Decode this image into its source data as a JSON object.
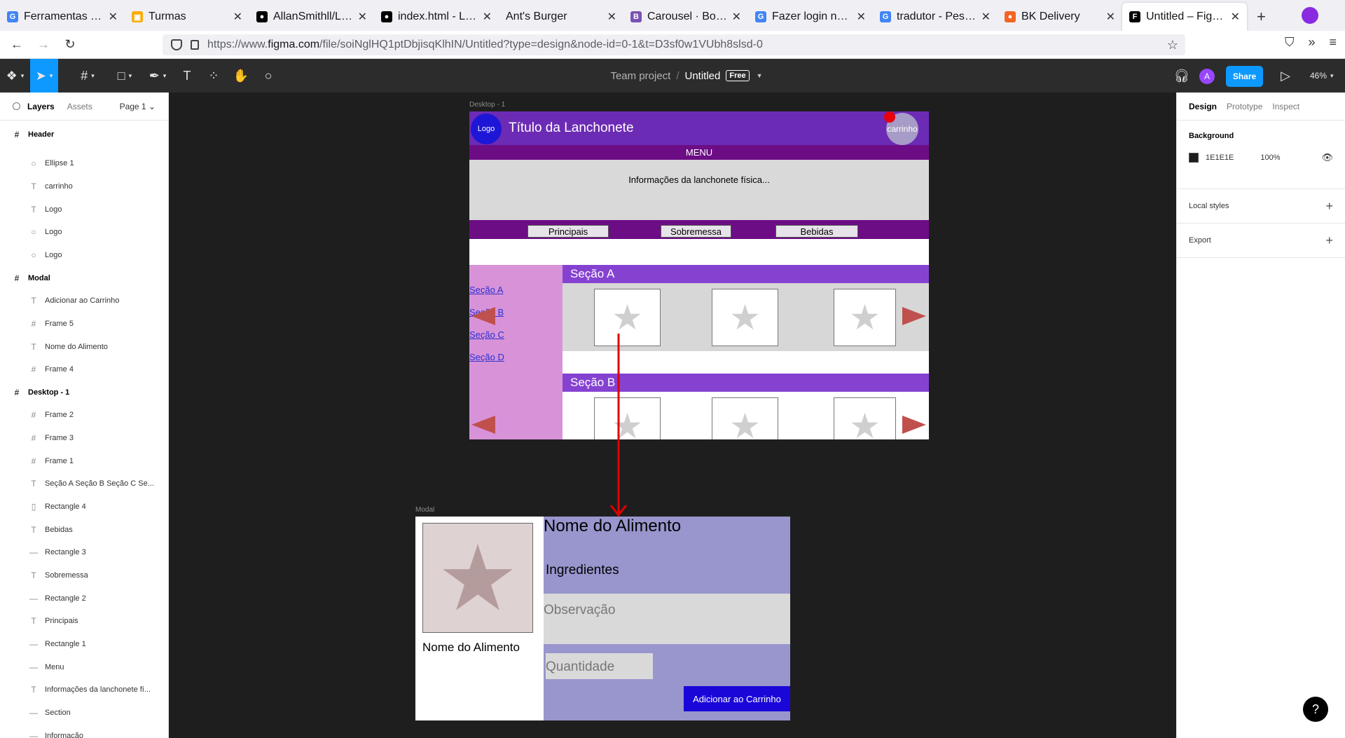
{
  "browser": {
    "tabs": [
      {
        "title": "Ferramentas e rec",
        "icon": "google-icon",
        "color": "#4285f4",
        "glyph": "G"
      },
      {
        "title": "Turmas",
        "icon": "classroom-icon",
        "color": "#f9ab00",
        "glyph": "▣"
      },
      {
        "title": "AllanSmithll/Lanc",
        "icon": "github-icon",
        "color": "#000000",
        "glyph": "●"
      },
      {
        "title": "index.html - Lanc",
        "icon": "github-icon",
        "color": "#000000",
        "glyph": "●"
      },
      {
        "title": "Ant's Burger",
        "icon": "",
        "color": "",
        "glyph": ""
      },
      {
        "title": "Carousel · Bootstr",
        "icon": "bootstrap-icon",
        "color": "#7952b3",
        "glyph": "B"
      },
      {
        "title": "Fazer login nas Co",
        "icon": "google-icon",
        "color": "#4285f4",
        "glyph": "G"
      },
      {
        "title": "tradutor - Pesquis",
        "icon": "google-icon",
        "color": "#4285f4",
        "glyph": "G"
      },
      {
        "title": "BK Delivery",
        "icon": "bk-icon",
        "color": "#f26522",
        "glyph": "●"
      },
      {
        "title": "Untitled – Figma",
        "icon": "figma-icon",
        "color": "#000000",
        "glyph": "F"
      }
    ],
    "url_prefix": "https://www.",
    "url_domain": "figma.com",
    "url_rest": "/file/soiNglHQ1ptDbjisqKlhIN/Untitled?type=design&node-id=0-1&t=D3sf0w1VUbh8slsd-0"
  },
  "figma": {
    "team": "Team project",
    "file": "Untitled",
    "plan_badge": "Free",
    "share": "Share",
    "zoom": "46%",
    "avatar": "A",
    "left_tabs": {
      "layers": "Layers",
      "assets": "Assets",
      "page": "Page 1"
    },
    "layers": [
      {
        "name": "Header",
        "kind": "frame",
        "icon": "frame-icon"
      },
      {
        "name": "Título da Lanchonete",
        "kind": "child",
        "icon": "text-icon"
      },
      {
        "name": "Ellipse 1",
        "kind": "child",
        "icon": "ellipse-icon"
      },
      {
        "name": "carrinho",
        "kind": "child",
        "icon": "text-icon"
      },
      {
        "name": "Logo",
        "kind": "child",
        "icon": "text-icon"
      },
      {
        "name": "Logo",
        "kind": "child",
        "icon": "ellipse-icon"
      },
      {
        "name": "Logo",
        "kind": "child",
        "icon": "ellipse-icon"
      },
      {
        "name": "Modal",
        "kind": "frame",
        "icon": "frame-icon"
      },
      {
        "name": "Adicionar ao Carrinho",
        "kind": "child",
        "icon": "text-icon"
      },
      {
        "name": "Frame 5",
        "kind": "child",
        "icon": "frame-icon"
      },
      {
        "name": "Nome do Alimento",
        "kind": "child",
        "icon": "text-icon"
      },
      {
        "name": "Frame 4",
        "kind": "child",
        "icon": "frame-icon"
      },
      {
        "name": "Desktop - 1",
        "kind": "frame",
        "icon": "frame-icon"
      },
      {
        "name": "Frame 2",
        "kind": "child",
        "icon": "frame-icon"
      },
      {
        "name": "Frame 3",
        "kind": "child",
        "icon": "frame-icon"
      },
      {
        "name": "Frame 1",
        "kind": "child",
        "icon": "frame-icon"
      },
      {
        "name": "Seção A Seção B Seção C Se...",
        "kind": "child",
        "icon": "text-icon"
      },
      {
        "name": "Rectangle 4",
        "kind": "child",
        "icon": "rectangle-icon"
      },
      {
        "name": "Bebidas",
        "kind": "child",
        "icon": "text-icon"
      },
      {
        "name": "Rectangle 3",
        "kind": "child",
        "icon": "line-icon"
      },
      {
        "name": "Sobremessa",
        "kind": "child",
        "icon": "text-icon"
      },
      {
        "name": "Rectangle 2",
        "kind": "child",
        "icon": "line-icon"
      },
      {
        "name": "Principais",
        "kind": "child",
        "icon": "text-icon"
      },
      {
        "name": "Rectangle 1",
        "kind": "child",
        "icon": "line-icon"
      },
      {
        "name": "Menu",
        "kind": "child",
        "icon": "line-icon"
      },
      {
        "name": "Informações da lanchonete fí...",
        "kind": "child",
        "icon": "text-icon"
      },
      {
        "name": "Section",
        "kind": "child",
        "icon": "line-icon"
      },
      {
        "name": "Informação",
        "kind": "child",
        "icon": "line-icon"
      }
    ],
    "right_tabs": {
      "design": "Design",
      "prototype": "Prototype",
      "inspect": "Inspect"
    },
    "background": {
      "label": "Background",
      "hex": "1E1E1E",
      "opacity": "100%",
      "swatch": "#1E1E1E"
    },
    "local_styles": "Local styles",
    "export": "Export"
  },
  "canvas": {
    "desktop_label": "Desktop - 1",
    "modal_label": "Modal",
    "desktop": {
      "logo": "Logo",
      "title": "Título da Lanchonete",
      "cart": "carrinho",
      "menu": "MENU",
      "info": "Informações da lanchonete física...",
      "categories": [
        "Principais",
        "Sobremessa",
        "Bebidas"
      ],
      "links": [
        "Seção A",
        "Seção B",
        "Seção C",
        "Seção D"
      ],
      "section_a": "Seção A",
      "section_b": "Seção B"
    },
    "modal": {
      "name_small": "Nome do Alimento",
      "name": "Nome do Alimento",
      "ingredients": "Ingredientes",
      "observation": "Observação",
      "quantity": "Quantidade",
      "add_button": "Adicionar ao Carrinho"
    }
  },
  "help": "?"
}
